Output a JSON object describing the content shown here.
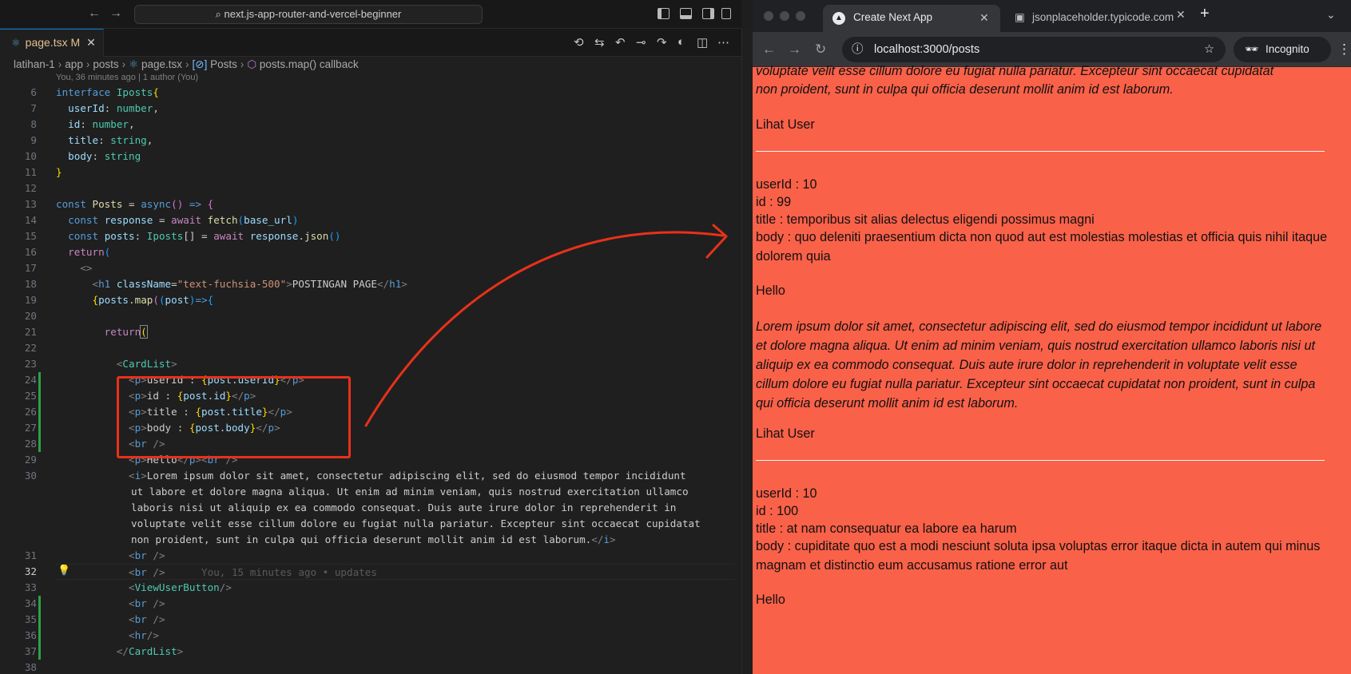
{
  "editor": {
    "title_search": "next.js-app-router-and-vercel-beginner",
    "tab": {
      "name": "page.tsx",
      "status": "M"
    },
    "breadcrumb": [
      "latihan-1",
      "app",
      "posts",
      "page.tsx",
      "Posts",
      "posts.map() callback"
    ],
    "blame_header": "You, 36 minutes ago | 1 author (You)",
    "inline_blame": "You, 15 minutes ago • updates",
    "current_line": "32"
  },
  "browser": {
    "tabs": [
      {
        "title": "Create Next App"
      },
      {
        "title": "jsonplaceholder.typicode.com"
      }
    ],
    "url": "localhost:3000/posts",
    "incognito_label": "Incognito",
    "posts": [
      {
        "lorem_tail1": "voluptate velit esse cillum dolore eu fugiat nulla pariatur. Excepteur sint occaecat cupidatat",
        "lorem_tail2": "non proident, sunt in culpa qui officia deserunt mollit anim id est laborum.",
        "button": "Lihat User"
      },
      {
        "userId": "userId : 10",
        "id": "id : 99",
        "title": "title : temporibus sit alias delectus eligendi possimus magni",
        "body": "body : quo deleniti praesentium dicta non quod aut est molestias molestias et officia quis nihil itaque dolorem quia",
        "hello": "Hello",
        "lorem": "Lorem ipsum dolor sit amet, consectetur adipiscing elit, sed do eiusmod tempor incididunt ut labore et dolore magna aliqua. Ut enim ad minim veniam, quis nostrud exercitation ullamco laboris nisi ut aliquip ex ea commodo consequat. Duis aute irure dolor in reprehenderit in voluptate velit esse cillum dolore eu fugiat nulla pariatur. Excepteur sint occaecat cupidatat non proident, sunt in culpa qui officia deserunt mollit anim id est laborum.",
        "button": "Lihat User"
      },
      {
        "userId": "userId : 10",
        "id": "id : 100",
        "title": "title : at nam consequatur ea labore ea harum",
        "body": "body : cupiditate quo est a modi nesciunt soluta ipsa voluptas error itaque dicta in autem qui minus magnam et distinctio eum accusamus ratione error aut",
        "hello": "Hello"
      }
    ]
  },
  "colors": {
    "page_bg": "#fa6149",
    "annotation": "#e8311a",
    "accent": "#0078d4"
  }
}
